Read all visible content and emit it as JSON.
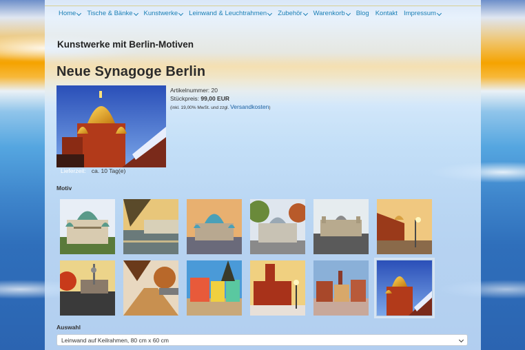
{
  "nav": {
    "items": [
      {
        "label": "Home",
        "dropdown": true
      },
      {
        "label": "Tische & Bänke",
        "dropdown": true
      },
      {
        "label": "Kunstwerke",
        "dropdown": true
      },
      {
        "label": "Leinwand & Leuchtrahmen",
        "dropdown": true
      },
      {
        "label": "Zubehör",
        "dropdown": true
      },
      {
        "label": "Warenkorb",
        "dropdown": true
      },
      {
        "label": "Blog",
        "dropdown": false
      },
      {
        "label": "Kontakt",
        "dropdown": false
      },
      {
        "label": "Impressum",
        "dropdown": true
      }
    ]
  },
  "section_title": "Kunstwerke mit Berlin-Motiven",
  "product": {
    "title": "Neue Synagoge Berlin",
    "article_label": "Artikelnummer:",
    "article_number": "20",
    "price_label": "Stückpreis:",
    "price": "99,00 EUR",
    "tax_note": "(inkl. 19,00% MwSt. und zzgl.",
    "shipping_link": "Versandkosten",
    "tax_close": ")",
    "delivery_label": "Lieferzeit:",
    "delivery_value": "ca. 10 Tag(e)"
  },
  "motiv": {
    "label": "Motiv",
    "thumbnails": [
      {
        "name": "berliner-dom-1"
      },
      {
        "name": "spree-riverside"
      },
      {
        "name": "berliner-dom-2"
      },
      {
        "name": "reichstag-trees"
      },
      {
        "name": "reichstag-river"
      },
      {
        "name": "street-scene"
      },
      {
        "name": "museum-island-autumn"
      },
      {
        "name": "autumn-promenade"
      },
      {
        "name": "colorful-square"
      },
      {
        "name": "red-town-hall"
      },
      {
        "name": "nikolaiviertel"
      },
      {
        "name": "neue-synagoge",
        "selected": true
      }
    ]
  },
  "auswahl": {
    "label": "Auswahl",
    "selected": "Leinwand auf Keilrahmen, 80 cm x 60 cm"
  }
}
